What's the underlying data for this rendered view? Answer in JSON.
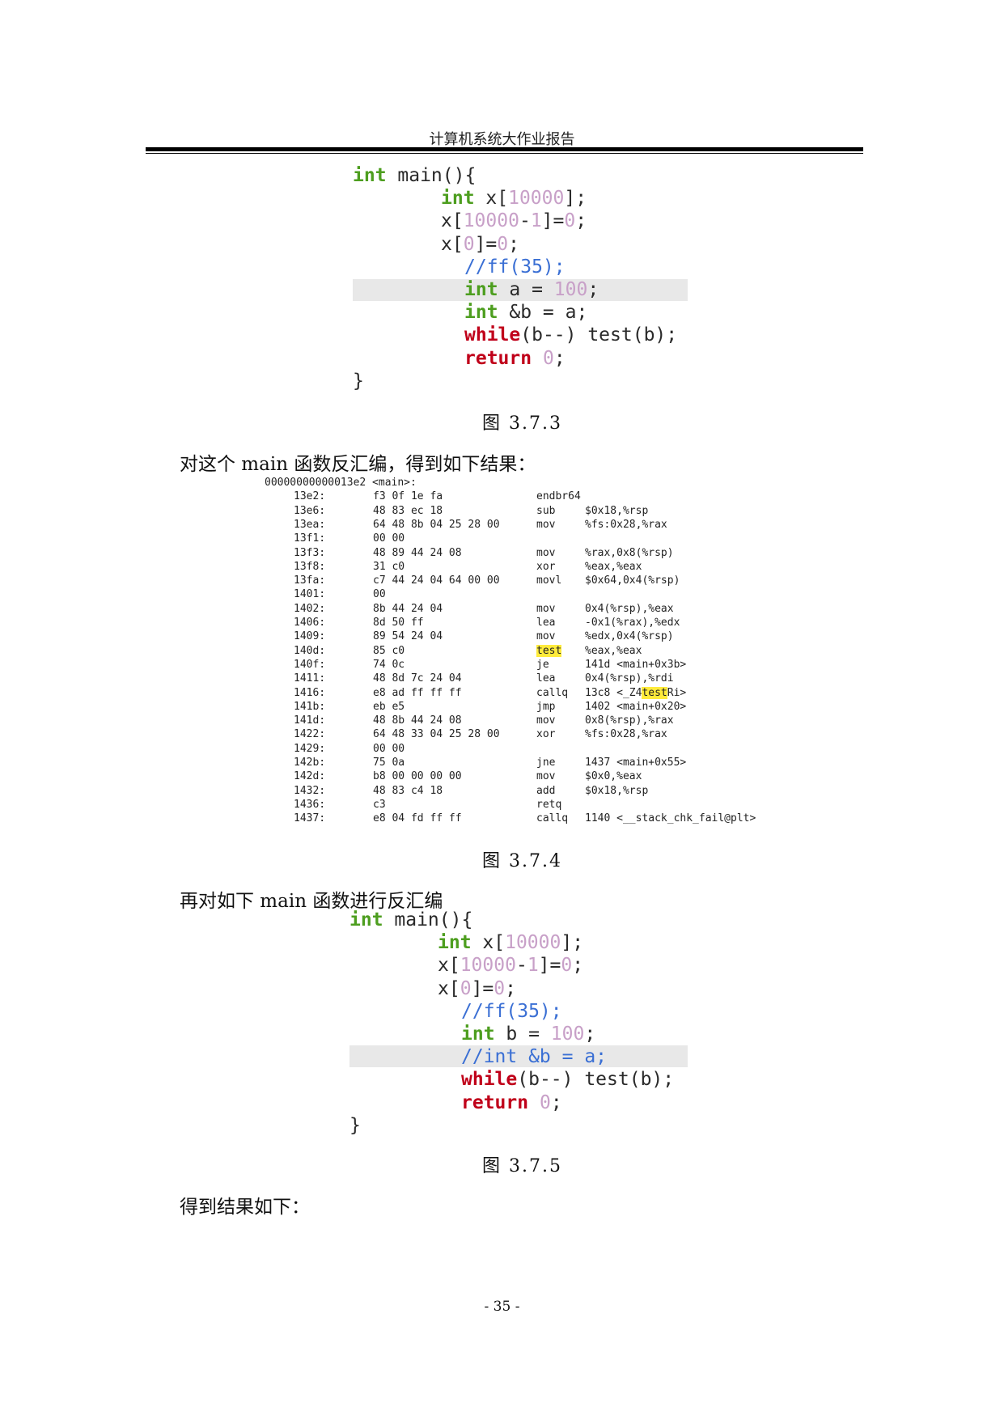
{
  "header": {
    "title": "计算机系统大作业报告"
  },
  "code1": {
    "lines": [
      {
        "kind": "fn",
        "kw": "int",
        "rest": " main(){"
      },
      {
        "kind": "arr",
        "kw": "int",
        "a": " x[",
        "n": "10000",
        "b": "];"
      },
      {
        "kind": "assign2",
        "a": "x[",
        "n1": "10000",
        "m": "-",
        "n2": "1",
        "b": "]=",
        "n3": "0",
        "c": ";"
      },
      {
        "kind": "assign1",
        "a": "x[",
        "n1": "0",
        "b": "]=",
        "n2": "0",
        "c": ";"
      },
      {
        "kind": "comment",
        "text": "//ff(35);"
      },
      {
        "kind": "decl",
        "kw": "int",
        "a": " a = ",
        "n": "100",
        "b": ";"
      },
      {
        "kind": "decl2",
        "kw": "int",
        "a": " &b = a;"
      },
      {
        "kind": "while",
        "kw": "while",
        "a": "(b--) test(b);"
      },
      {
        "kind": "ret",
        "kw": "return",
        "n": "0",
        "b": ";"
      },
      {
        "kind": "close",
        "text": "}"
      }
    ]
  },
  "caption1": "图 3.7.3",
  "para1": "对这个 main 函数反汇编，得到如下结果：",
  "disasm": {
    "header": "00000000000013e2 <main>:",
    "rows": [
      [
        "13e2:",
        "f3 0f 1e fa",
        "endbr64",
        ""
      ],
      [
        "13e6:",
        "48 83 ec 18",
        "sub",
        "$0x18,%rsp"
      ],
      [
        "13ea:",
        "64 48 8b 04 25 28 00",
        "mov",
        "%fs:0x28,%rax"
      ],
      [
        "13f1:",
        "00 00",
        "",
        ""
      ],
      [
        "13f3:",
        "48 89 44 24 08",
        "mov",
        "%rax,0x8(%rsp)"
      ],
      [
        "13f8:",
        "31 c0",
        "xor",
        "%eax,%eax"
      ],
      [
        "13fa:",
        "c7 44 24 04 64 00 00",
        "movl",
        "$0x64,0x4(%rsp)"
      ],
      [
        "1401:",
        "00",
        "",
        ""
      ],
      [
        "1402:",
        "8b 44 24 04",
        "mov",
        "0x4(%rsp),%eax"
      ],
      [
        "1406:",
        "8d 50 ff",
        "lea",
        "-0x1(%rax),%edx"
      ],
      [
        "1409:",
        "89 54 24 04",
        "mov",
        "%edx,0x4(%rsp)"
      ],
      [
        "140d:",
        "85 c0",
        "test",
        "%eax,%eax"
      ],
      [
        "140f:",
        "74 0c",
        "je",
        "141d <main+0x3b>"
      ],
      [
        "1411:",
        "48 8d 7c 24 04",
        "lea",
        "0x4(%rsp),%rdi"
      ],
      [
        "1416:",
        "e8 ad ff ff ff",
        "callq",
        "13c8 <_Z4testRi>"
      ],
      [
        "141b:",
        "eb e5",
        "jmp",
        "1402 <main+0x20>"
      ],
      [
        "141d:",
        "48 8b 44 24 08",
        "mov",
        "0x8(%rsp),%rax"
      ],
      [
        "1422:",
        "64 48 33 04 25 28 00",
        "xor",
        "%fs:0x28,%rax"
      ],
      [
        "1429:",
        "00 00",
        "",
        ""
      ],
      [
        "142b:",
        "75 0a",
        "jne",
        "1437 <main+0x55>"
      ],
      [
        "142d:",
        "b8 00 00 00 00",
        "mov",
        "$0x0,%eax"
      ],
      [
        "1432:",
        "48 83 c4 18",
        "add",
        "$0x18,%rsp"
      ],
      [
        "1436:",
        "c3",
        "retq",
        ""
      ],
      [
        "1437:",
        "e8 04 fd ff ff",
        "callq",
        "1140 <__stack_chk_fail@plt>"
      ]
    ],
    "hl_row11_op": "test",
    "hl_row14_pre": "13c8 <_Z4",
    "hl_row14_mid": "test",
    "hl_row14_post": "Ri>"
  },
  "caption2": "图 3.7.4",
  "para2": "再对如下 main 函数进行反汇编",
  "code2": {
    "lines": [
      {
        "kind": "fn",
        "kw": "int",
        "rest": " main(){"
      },
      {
        "kind": "arr",
        "kw": "int",
        "a": " x[",
        "n": "10000",
        "b": "];"
      },
      {
        "kind": "assign2",
        "a": "x[",
        "n1": "10000",
        "m": "-",
        "n2": "1",
        "b": "]=",
        "n3": "0",
        "c": ";"
      },
      {
        "kind": "assign1",
        "a": "x[",
        "n1": "0",
        "b": "]=",
        "n2": "0",
        "c": ";"
      },
      {
        "kind": "comment",
        "text": "//ff(35);"
      },
      {
        "kind": "decl",
        "kw": "int",
        "a": " b = ",
        "n": "100",
        "b": ";"
      },
      {
        "kind": "comment",
        "text": "//int &b = a;"
      },
      {
        "kind": "while",
        "kw": "while",
        "a": "(b--) test(b);"
      },
      {
        "kind": "ret",
        "kw": "return",
        "n": "0",
        "b": ";"
      },
      {
        "kind": "close",
        "text": "}"
      }
    ]
  },
  "caption3": "图 3.7.5",
  "para3": "得到结果如下：",
  "page_number": "- 35 -"
}
